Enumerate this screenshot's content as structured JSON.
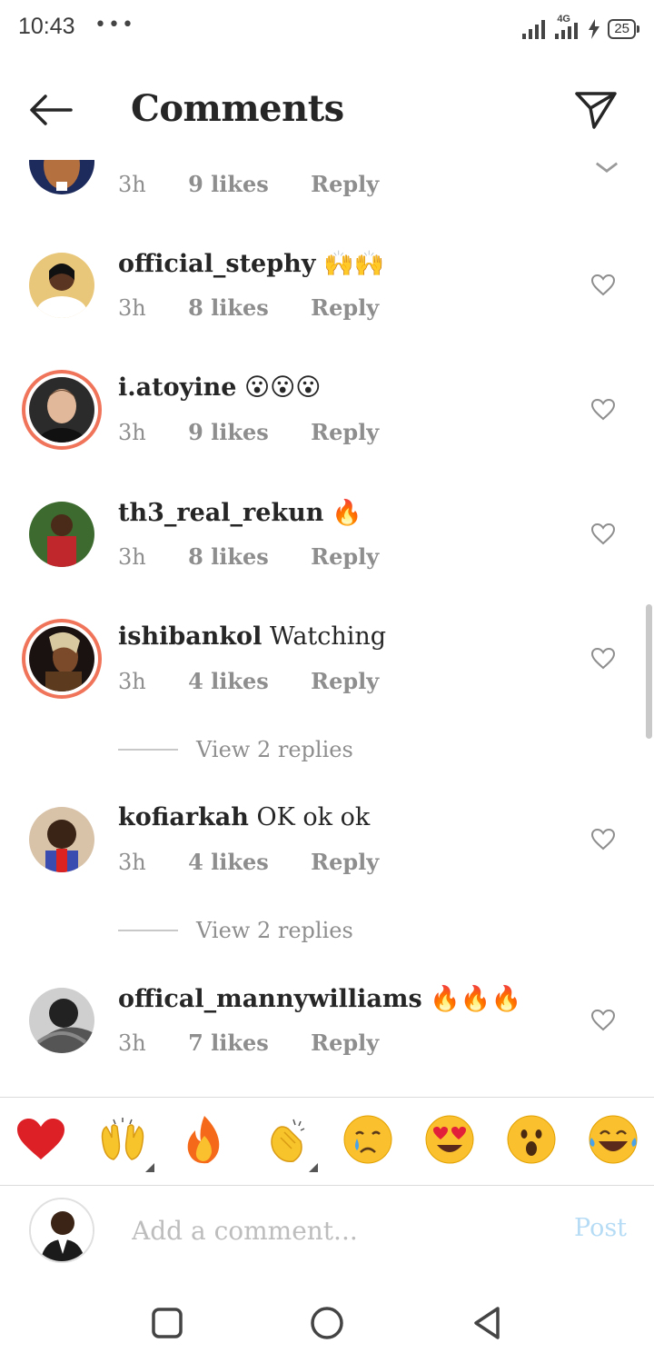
{
  "status_bar": {
    "time": "10:43",
    "dots": "•••",
    "network": "4G",
    "battery": "25"
  },
  "header": {
    "title": "Comments"
  },
  "comments": [
    {
      "user": "",
      "text": "",
      "time": "3h",
      "likes": "9 likes",
      "reply": "Reply"
    },
    {
      "user": "official_stephy",
      "text": "",
      "emojis": "🙌🙌",
      "time": "3h",
      "likes": "8 likes",
      "reply": "Reply"
    },
    {
      "user": "i.atoyine",
      "text": "",
      "emojis": "😮😮😮",
      "time": "3h",
      "likes": "9 likes",
      "reply": "Reply"
    },
    {
      "user": "th3_real_rekun",
      "text": "",
      "emojis": "🔥",
      "time": "3h",
      "likes": "8 likes",
      "reply": "Reply"
    },
    {
      "user": "ishibankol",
      "text": "Watching",
      "time": "3h",
      "likes": "4 likes",
      "reply": "Reply",
      "view_replies": "View 2 replies"
    },
    {
      "user": "kofiarkah",
      "text": "OK ok ok",
      "time": "3h",
      "likes": "4 likes",
      "reply": "Reply",
      "view_replies": "View 2 replies"
    },
    {
      "user": "offical_mannywilliams",
      "text": "",
      "emojis": "🔥🔥🔥",
      "time": "3h",
      "likes": "7 likes",
      "reply": "Reply"
    }
  ],
  "reactions": [
    "❤️",
    "🙌",
    "🔥",
    "👏",
    "😢",
    "😍",
    "😮",
    "😂"
  ],
  "composer": {
    "placeholder": "Add a comment...",
    "post_label": "Post"
  },
  "colors": {
    "text": "#262626",
    "muted": "#8e8e8e",
    "post_disabled": "#b6dcf5",
    "story_ring": "#f0745a"
  }
}
